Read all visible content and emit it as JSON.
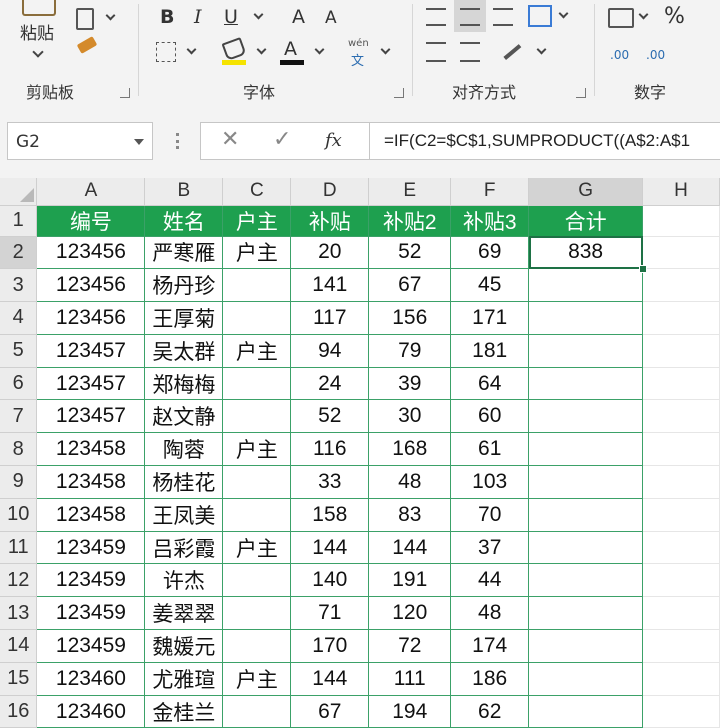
{
  "ribbon": {
    "clipboard": {
      "paste_label": "粘贴",
      "group_label": "剪贴板"
    },
    "font": {
      "group_label": "字体",
      "bold": "B",
      "italic": "I",
      "underline": "U",
      "grow": "A",
      "shrink": "A",
      "font_color": "A",
      "phonetic_top": "wén",
      "phonetic_bottom": "文"
    },
    "alignment": {
      "group_label": "对齐方式"
    },
    "number": {
      "group_label": "数字",
      "percent": "%",
      "inc_decimal": ".00",
      "dec_decimal": ".00"
    }
  },
  "formula_bar": {
    "name_box": "G2",
    "fx": "fx",
    "formula": "=IF(C2=$C$1,SUMPRODUCT((A$2:A$1"
  },
  "sheet": {
    "columns": [
      "A",
      "B",
      "C",
      "D",
      "E",
      "F",
      "G",
      "H"
    ],
    "header_row": [
      "编号",
      "姓名",
      "户主",
      "补贴",
      "补贴2",
      "补贴3",
      "合计"
    ],
    "rows": [
      {
        "num": "2",
        "cells": [
          "123456",
          "严寒雁",
          "户主",
          "20",
          "52",
          "69",
          "838"
        ]
      },
      {
        "num": "3",
        "cells": [
          "123456",
          "杨丹珍",
          "",
          "141",
          "67",
          "45",
          ""
        ]
      },
      {
        "num": "4",
        "cells": [
          "123456",
          "王厚菊",
          "",
          "117",
          "156",
          "171",
          ""
        ]
      },
      {
        "num": "5",
        "cells": [
          "123457",
          "吴太群",
          "户主",
          "94",
          "79",
          "181",
          ""
        ]
      },
      {
        "num": "6",
        "cells": [
          "123457",
          "郑梅梅",
          "",
          "24",
          "39",
          "64",
          ""
        ]
      },
      {
        "num": "7",
        "cells": [
          "123457",
          "赵文静",
          "",
          "52",
          "30",
          "60",
          ""
        ]
      },
      {
        "num": "8",
        "cells": [
          "123458",
          "陶蓉",
          "户主",
          "116",
          "168",
          "61",
          ""
        ]
      },
      {
        "num": "9",
        "cells": [
          "123458",
          "杨桂花",
          "",
          "33",
          "48",
          "103",
          ""
        ]
      },
      {
        "num": "10",
        "cells": [
          "123458",
          "王凤美",
          "",
          "158",
          "83",
          "70",
          ""
        ]
      },
      {
        "num": "11",
        "cells": [
          "123459",
          "吕彩霞",
          "户主",
          "144",
          "144",
          "37",
          ""
        ]
      },
      {
        "num": "12",
        "cells": [
          "123459",
          "许杰",
          "",
          "140",
          "191",
          "44",
          ""
        ]
      },
      {
        "num": "13",
        "cells": [
          "123459",
          "姜翠翠",
          "",
          "71",
          "120",
          "48",
          ""
        ]
      },
      {
        "num": "14",
        "cells": [
          "123459",
          "魏媛元",
          "",
          "170",
          "72",
          "174",
          ""
        ]
      },
      {
        "num": "15",
        "cells": [
          "123460",
          "尤雅瑄",
          "户主",
          "144",
          "111",
          "186",
          ""
        ]
      },
      {
        "num": "16",
        "cells": [
          "123460",
          "金桂兰",
          "",
          "67",
          "194",
          "62",
          ""
        ]
      }
    ]
  },
  "colors": {
    "header_fill": "#1ea04f",
    "table_border": "#3ba168",
    "selection": "#1e7145"
  }
}
